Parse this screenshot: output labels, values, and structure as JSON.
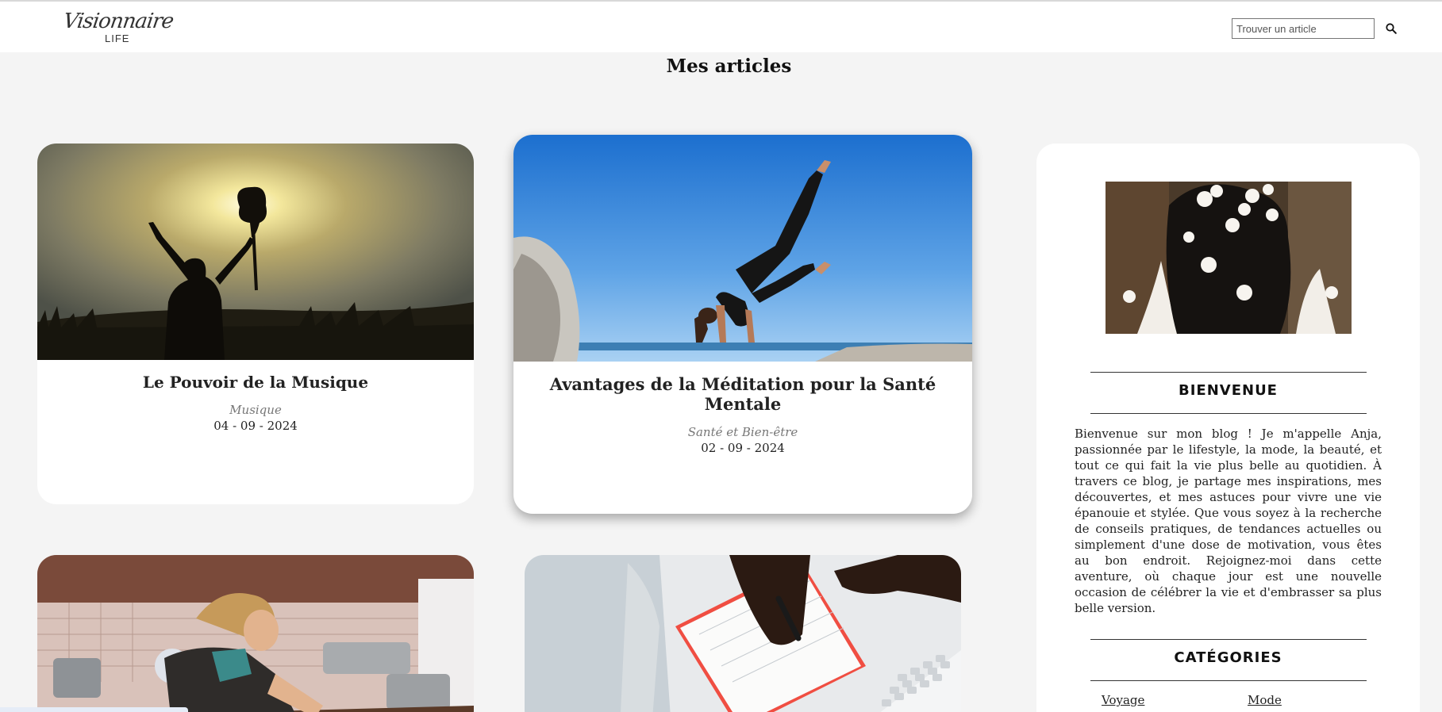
{
  "header": {
    "logo_script": "Visionnaire",
    "logo_sub": "LIFE",
    "search_placeholder": "Trouver un article",
    "search_icon": "search-icon"
  },
  "page_title": "Mes articles",
  "articles": [
    {
      "title": "Le Pouvoir de la Musique",
      "category": "Musique",
      "date": "04 - 09 - 2024"
    },
    {
      "title": "Avantages de la Méditation pour la Santé Mentale",
      "category": "Santé et Bien-être",
      "date": "02 - 09 - 2024"
    }
  ],
  "sidebar": {
    "welcome_heading": "BIENVENUE",
    "welcome_text": "Bienvenue sur mon blog ! Je m'appelle Anja, passionnée par le lifestyle, la mode, la beauté, et tout ce qui fait la vie plus belle au quotidien. À travers ce blog, je partage mes inspirations, mes découvertes, et mes astuces pour vivre une vie épanouie et stylée. Que vous soyez à la recherche de conseils pratiques, de tendances actuelles ou simplement d'une dose de motivation, vous êtes au bon endroit. Rejoignez-moi dans cette aventure, où chaque jour est une nouvelle occasion de célébrer la vie et d'embrasser sa plus belle version.",
    "categories_heading": "CATÉGORIES",
    "categories": [
      "Voyage",
      "Mode"
    ]
  },
  "colors": {
    "page_bg": "#f4f4f4",
    "card_bg": "#ffffff",
    "muted_text": "#777777"
  }
}
